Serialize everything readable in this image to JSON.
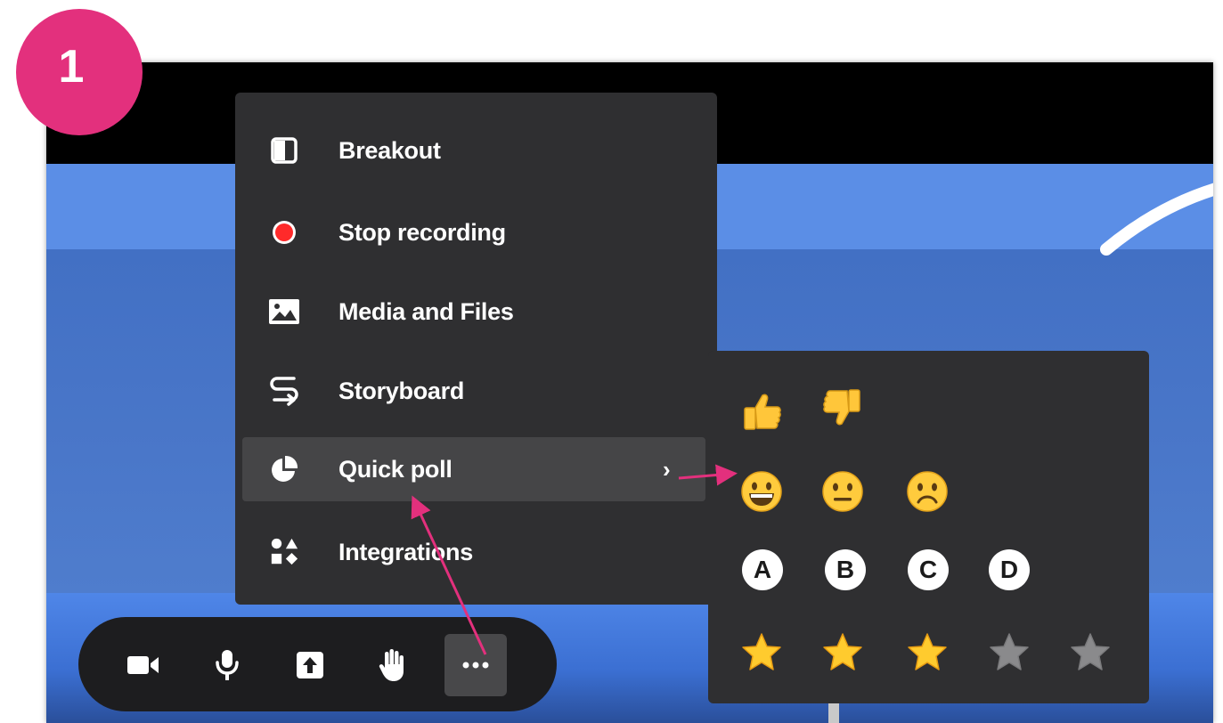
{
  "step_badge": "1",
  "more_menu": {
    "items": [
      {
        "label": "Breakout",
        "icon": "breakout-icon"
      },
      {
        "label": "Stop recording",
        "icon": "record-icon"
      },
      {
        "label": "Media and Files",
        "icon": "image-icon"
      },
      {
        "label": "Storyboard",
        "icon": "storyboard-icon"
      },
      {
        "label": "Quick poll",
        "icon": "pie-chart-icon",
        "active": true,
        "has_submenu": true,
        "chevron": "›"
      },
      {
        "label": "Integrations",
        "icon": "shapes-icon"
      }
    ]
  },
  "quick_poll": {
    "thumbs": [
      "👍",
      "👎"
    ],
    "faces": [
      "😀",
      "😐",
      "☹️"
    ],
    "letters": [
      "A",
      "B",
      "C",
      "D"
    ],
    "stars": {
      "total": 5,
      "filled": 3
    }
  },
  "toolbar": {
    "buttons": [
      {
        "name": "camera",
        "icon": "video-camera-icon"
      },
      {
        "name": "microphone",
        "icon": "microphone-icon"
      },
      {
        "name": "share-screen",
        "icon": "upload-icon"
      },
      {
        "name": "raise-hand",
        "icon": "hand-icon"
      },
      {
        "name": "more",
        "icon": "more-dots-icon",
        "active": true
      }
    ]
  },
  "colors": {
    "menu_bg": "#2f2f31",
    "menu_active": "#454547",
    "toolbar_bg": "#1d1d1f",
    "badge": "#e3307d",
    "arrow": "#e3307d",
    "record_red": "#ff2a2a",
    "star_gold": "#ffcb2e",
    "star_gray": "#8a8a8c"
  }
}
